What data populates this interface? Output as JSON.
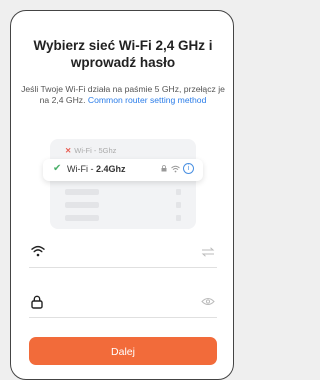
{
  "title": "Wybierz sieć Wi-Fi 2,4 GHz i wprowadź hasło",
  "description": {
    "text": "Jeśli Twoje Wi-Fi działa na paśmie 5 GHz, przełącz je na 2,4 GHz.",
    "link": "Common router setting method"
  },
  "illustration": {
    "bad_network": "Wi-Fi - 5Ghz",
    "good_network_prefix": "Wi-Fi - ",
    "good_network_band": "2.4Ghz"
  },
  "wifi_field": {
    "value": "",
    "placeholder": ""
  },
  "password_field": {
    "value": "",
    "placeholder": ""
  },
  "next_button": "Dalej",
  "colors": {
    "accent": "#f26b3a",
    "link": "#2b7de9",
    "check": "#4ab06a",
    "error": "#e85a4f"
  }
}
